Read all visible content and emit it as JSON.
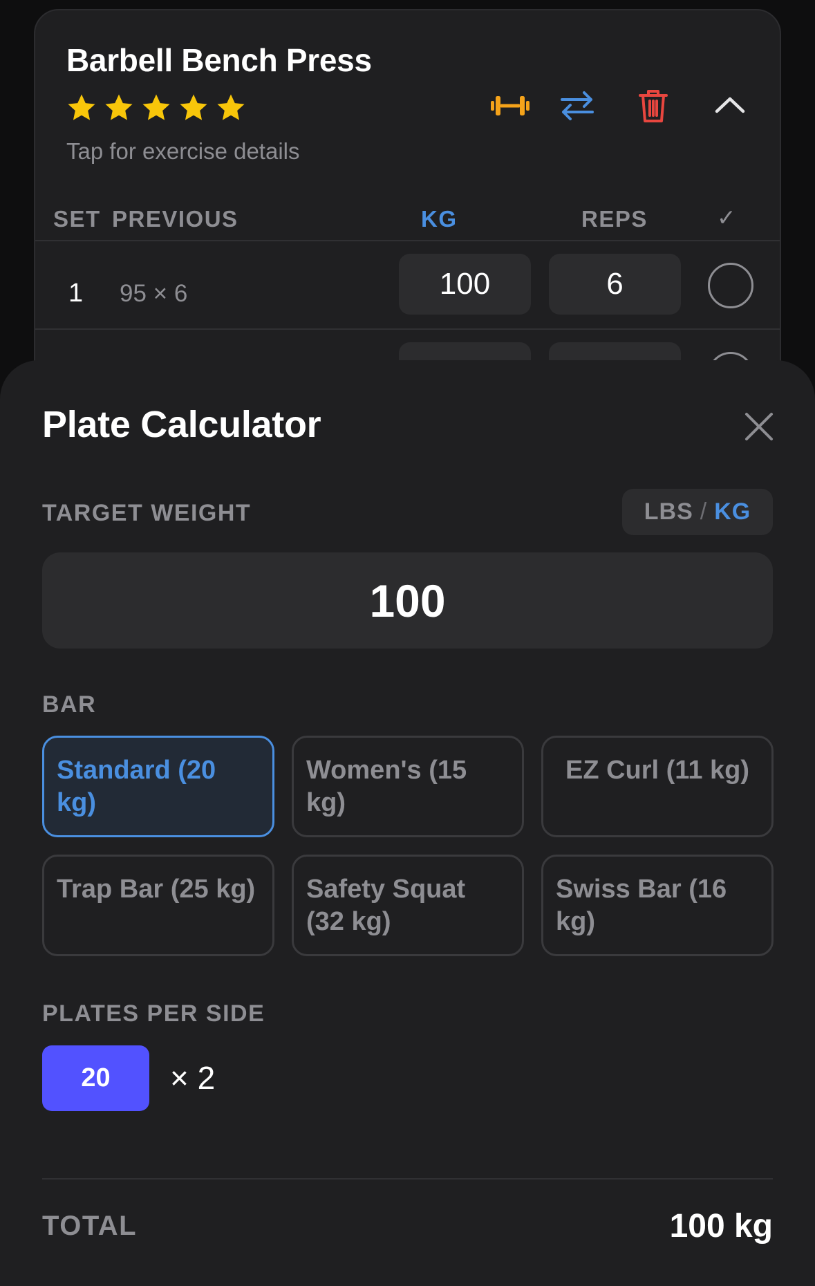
{
  "exercise": {
    "title": "Barbell Bench Press",
    "rating": 5,
    "subtitle": "Tap for exercise details",
    "headers": {
      "set": "SET",
      "previous": "PREVIOUS",
      "kg": "KG",
      "reps": "REPS",
      "check": "✓"
    },
    "sets": [
      {
        "num": "1",
        "previous": "95 × 6",
        "kg": "100",
        "reps": "6",
        "completed": false
      }
    ]
  },
  "colors": {
    "accent_blue": "#4a8fe0",
    "star_yellow": "#f8c60a",
    "dumbbell_orange": "#f5a31a",
    "trash_red": "#e8463f",
    "plate_chip": "#5252ff"
  },
  "icons": [
    "dumbbell-icon",
    "swap-icon",
    "trash-icon",
    "chevron-up-icon",
    "close-icon",
    "star-icon"
  ],
  "sheet": {
    "title": "Plate Calculator",
    "target_label": "TARGET WEIGHT",
    "unit_lbs": "LBS",
    "unit_sep": "/",
    "unit_kg": "KG",
    "selected_unit": "KG",
    "target_value": "100",
    "bar_label": "BAR",
    "bars": [
      {
        "label": "Standard (20 kg)",
        "selected": true
      },
      {
        "label": "Women's (15 kg)",
        "selected": false
      },
      {
        "label": "EZ Curl (11 kg)",
        "selected": false
      },
      {
        "label": "Trap Bar (25 kg)",
        "selected": false
      },
      {
        "label": "Safety Squat (32 kg)",
        "selected": false
      },
      {
        "label": "Swiss Bar (16 kg)",
        "selected": false
      }
    ],
    "plates_label": "PLATES PER SIDE",
    "plates": [
      {
        "weight": "20",
        "count": "× 2"
      }
    ],
    "total_label": "TOTAL",
    "total_value": "100 kg"
  }
}
